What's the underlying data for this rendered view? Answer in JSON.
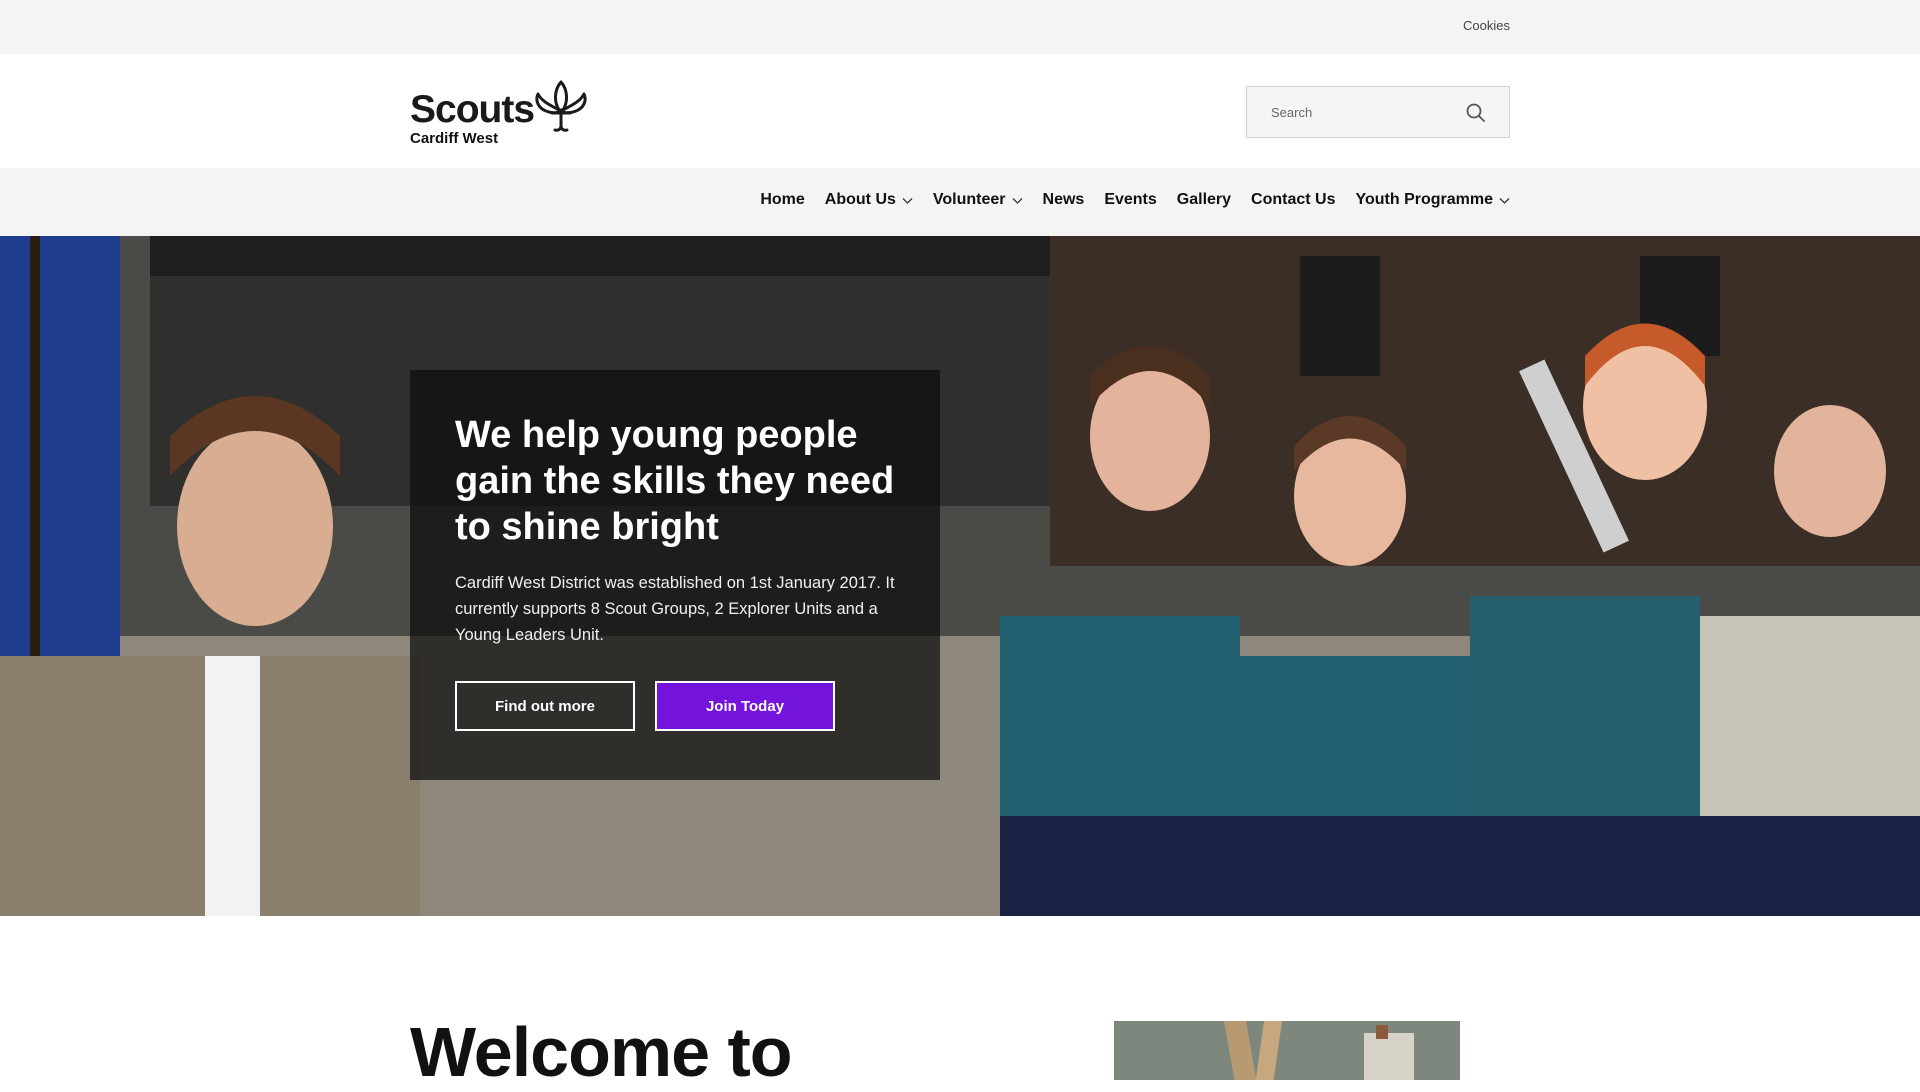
{
  "topbar": {
    "cookies_label": "Cookies"
  },
  "header": {
    "logo_word": "Scouts",
    "logo_sub": "Cardiff West",
    "search_placeholder": "Search"
  },
  "nav": {
    "items": [
      {
        "label": "Home",
        "dropdown": false
      },
      {
        "label": "About Us",
        "dropdown": true
      },
      {
        "label": "Volunteer",
        "dropdown": true
      },
      {
        "label": "News",
        "dropdown": false
      },
      {
        "label": "Events",
        "dropdown": false
      },
      {
        "label": "Gallery",
        "dropdown": false
      },
      {
        "label": "Contact Us",
        "dropdown": false
      },
      {
        "label": "Youth Programme",
        "dropdown": true
      }
    ]
  },
  "hero": {
    "heading": "We help young people gain the skills they need to shine bright",
    "body": "Cardiff West District was established on 1st January 2017. It currently supports 8 Scout Groups, 2 Explorer Units and a Young Leaders Unit.",
    "find_out_more_label": "Find out more",
    "join_today_label": "Join Today"
  },
  "welcome": {
    "title": "Welcome to"
  },
  "colors": {
    "accent": "#7413dc",
    "topbar_bg": "#f4f4f4",
    "panel_bg": "#0c0c0c"
  },
  "icons": {
    "search": "search-icon",
    "logo": "fleur-de-lis-icon",
    "dropdown": "chevron-down-icon"
  }
}
